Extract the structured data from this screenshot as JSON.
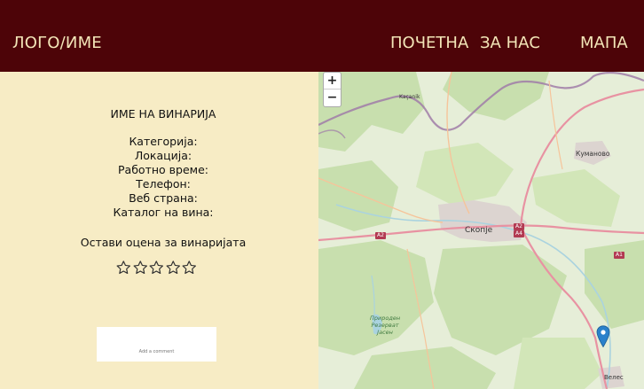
{
  "nav": {
    "logo": "ЛОГО/ИМЕ",
    "home": "ПОЧЕТНА",
    "about": "ЗА НАС",
    "map": "МАПА"
  },
  "winery": {
    "name": "ИМЕ НА ВИНАРИЈА",
    "fields": [
      "Категорија:",
      "Локација:",
      "Работно време:",
      "Телефон:",
      "Веб страна:",
      "Каталог на вина:"
    ]
  },
  "rating": {
    "label": "Остави оцена за винаријата",
    "value": 0,
    "max": 5
  },
  "comment": {
    "placeholder": "Add a comment"
  },
  "map": {
    "zoom_in": "+",
    "zoom_out": "−",
    "labels": {
      "skopje": "Скопје",
      "kumanovo": "Куманово",
      "veles": "Велес",
      "kacanik": "Kaçanik",
      "reserve_1": "Природен",
      "reserve_2": "Резерват",
      "reserve_3": "Јасен"
    },
    "roads": {
      "a2_west": "A2",
      "a2_east": "A2",
      "a4": "A4",
      "a1": "A1"
    },
    "colors": {
      "forest": "#c8dfae",
      "land": "#e6eed8",
      "urban": "#dcd4d0",
      "motorway": "#e892a2",
      "border": "#a07ca8",
      "water": "#aad3df",
      "marker": "#2a81cb"
    }
  }
}
